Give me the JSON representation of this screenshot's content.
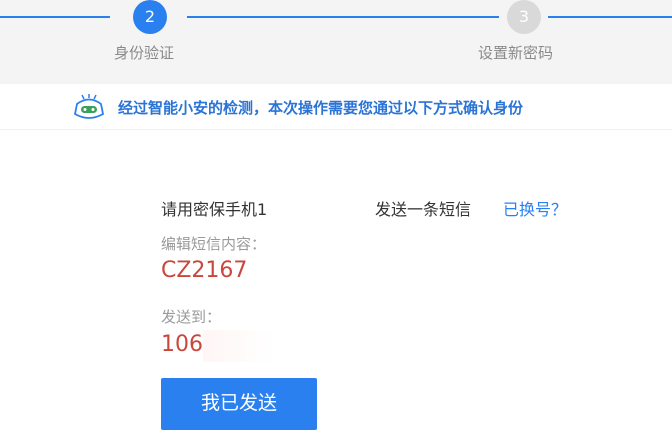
{
  "stepper": {
    "step2": {
      "number": "2",
      "label": "身份验证"
    },
    "step3": {
      "number": "3",
      "label": "设置新密码"
    }
  },
  "notice": {
    "icon": "robot-icon",
    "text": "经过智能小安的检测，本次操作需要您通过以下方式确认身份"
  },
  "verify": {
    "line_prefix": "请用密保手机1",
    "line_suffix": "发送一条短信",
    "changed_link": "已换号？",
    "content_label": "编辑短信内容：",
    "content_value": "CZ2167",
    "send_to_label": "发送到：",
    "send_to_value": "106",
    "button_label": "我已发送"
  },
  "colors": {
    "accent": "#2b80f0",
    "code_red": "#c9473c",
    "inactive_step": "#d9d9d9"
  }
}
